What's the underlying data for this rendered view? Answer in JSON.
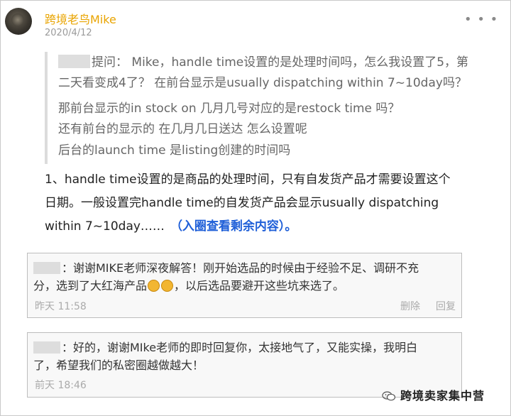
{
  "post": {
    "author": "跨境老鸟Mike",
    "date": "2020/4/12"
  },
  "quote": {
    "line1_a": "提问：  Mike，handle time设置的是处理时间吗，怎么我设置了5，第",
    "line1_b": "二天看变成4了？   在前台显示是usually  dispatching within 7~10day吗？",
    "line2": "那前台显示的in stock on 几月几号对应的是restock time 吗？",
    "line3": "还有前台的显示的 在几月几日送达 怎么设置呢",
    "line4": "后台的launch time 是listing创建的时间吗"
  },
  "answer": {
    "line1": "1、handle time设置的是商品的处理时间，只有自发货产品才需要设置这个",
    "line2": "日期。一般设置完handle time的自发货产品会显示usually  dispatching",
    "line3": "within 7~10day……",
    "link": "（入圈查看剩余内容）。"
  },
  "comments": [
    {
      "text_a": "：谢谢MIKE老师深夜解答！刚开始选品的时候由于经验不足、调研不充",
      "text_b": "分，选到了大红海产品",
      "text_c": "，以后选品要避开这些坑来选了。",
      "time": "昨天 11:58",
      "delete": "删除",
      "reply": "回复"
    },
    {
      "text_a": "：好的，谢谢MIke老师的即时回复你，太接地气了，又能实操，我明白",
      "text_b": "了，希望我们的私密圈越做越大！",
      "time": "前天 18:46"
    }
  ],
  "watermark": "跨境卖家集中营",
  "colors": {
    "author": "#e9a400",
    "link": "#1f5fd8"
  }
}
